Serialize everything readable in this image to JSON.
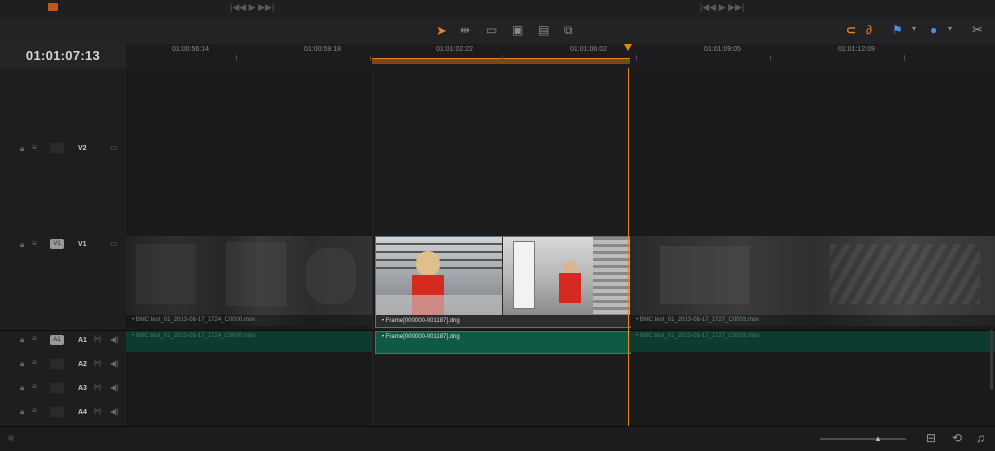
{
  "timecode": "01:01:07:13",
  "ruler_labels": [
    "01:00:56:14",
    "01:00:59:18",
    "01:01:02:22",
    "01:01:06:02",
    "01:01:09:05",
    "01:01:12:09"
  ],
  "tracks": {
    "video": [
      {
        "name": "V2",
        "badge": ""
      },
      {
        "name": "V1",
        "badge": "V1"
      }
    ],
    "audio": [
      {
        "name": "A1",
        "badge": "A1"
      },
      {
        "name": "A2",
        "badge": ""
      },
      {
        "name": "A3",
        "badge": ""
      },
      {
        "name": "A4",
        "badge": ""
      }
    ]
  },
  "clips": {
    "v1_left": "• BMC test_01_2013-06-17_1724_C0000.mov",
    "v1_mid": "• Frame[000000-001187].dng",
    "v1_right": "• BMC test_01_2013-06-17_1727_C0003.mov",
    "a1_left": "• BMC test_01_2013-06-17_1724_C0000.mov",
    "a1_mid": "• Frame[000000-001187].dng",
    "a1_right": "• BMC test_01_2013-06-17_1727_C0003.mov"
  },
  "colors": {
    "accent": "#e8821e",
    "audio_clip": "#0e4a3a",
    "audio_sel": "#1a6a52",
    "playhead": "#e8821e"
  },
  "icons": [
    "select-icon",
    "trim-icon",
    "blade-icon",
    "insert-icon",
    "overwrite-icon",
    "replace-icon",
    "snap-icon",
    "link-icon",
    "flag-icon",
    "marker-icon",
    "settings-icon",
    "zoom-slider",
    "detail-icon",
    "history-icon",
    "audio-icon"
  ]
}
